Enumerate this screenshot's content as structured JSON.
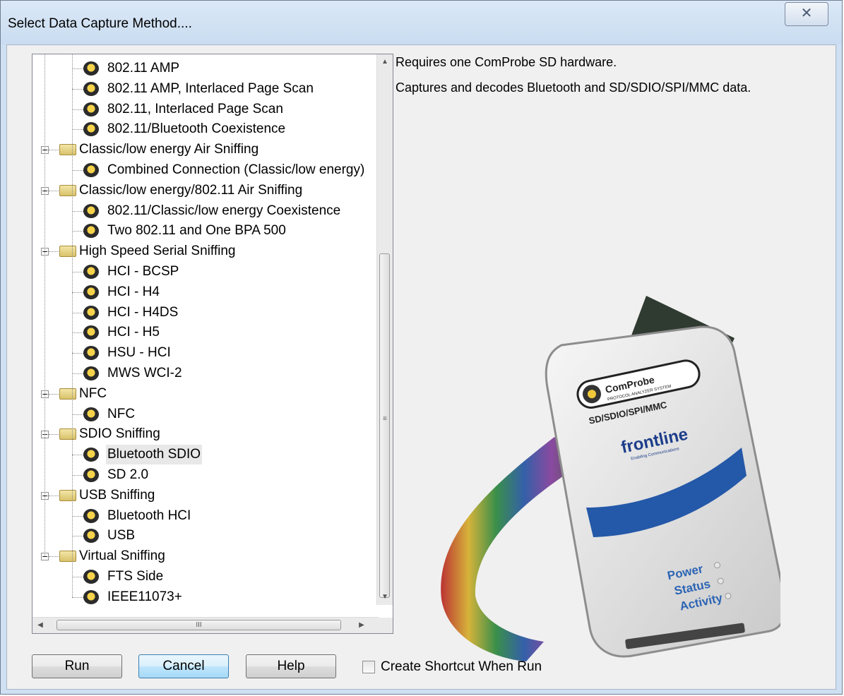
{
  "window": {
    "title": "Select Data Capture Method....",
    "close_glyph": "✕"
  },
  "tree": {
    "items": [
      {
        "label": "802.11 AMP",
        "level": 2,
        "icon": "probe-node-icon"
      },
      {
        "label": "802.11 AMP, Interlaced Page Scan",
        "level": 2,
        "icon": "probe-node-icon"
      },
      {
        "label": "802.11, Interlaced Page Scan",
        "level": 2,
        "icon": "probe-node-icon"
      },
      {
        "label": "802.11/Bluetooth Coexistence",
        "level": 2,
        "icon": "probe-node-icon"
      },
      {
        "label": "Classic/low energy Air Sniffing",
        "level": 1,
        "icon": "folder-icon",
        "expander": "−"
      },
      {
        "label": "Combined Connection (Classic/low energy)",
        "level": 2,
        "icon": "probe-node-icon"
      },
      {
        "label": "Classic/low energy/802.11 Air Sniffing",
        "level": 1,
        "icon": "folder-icon",
        "expander": "−"
      },
      {
        "label": "802.11/Classic/low energy Coexistence",
        "level": 2,
        "icon": "probe-node-icon"
      },
      {
        "label": "Two 802.11 and One BPA 500",
        "level": 2,
        "icon": "probe-node-icon"
      },
      {
        "label": "High Speed Serial Sniffing",
        "level": 1,
        "icon": "folder-icon",
        "expander": "−"
      },
      {
        "label": "HCI - BCSP",
        "level": 2,
        "icon": "probe-node-icon"
      },
      {
        "label": "HCI - H4",
        "level": 2,
        "icon": "probe-node-icon"
      },
      {
        "label": "HCI - H4DS",
        "level": 2,
        "icon": "probe-node-icon"
      },
      {
        "label": "HCI - H5",
        "level": 2,
        "icon": "probe-node-icon"
      },
      {
        "label": "HSU - HCI",
        "level": 2,
        "icon": "probe-node-icon"
      },
      {
        "label": "MWS WCI-2",
        "level": 2,
        "icon": "probe-node-icon"
      },
      {
        "label": "NFC",
        "level": 1,
        "icon": "folder-icon",
        "expander": "−"
      },
      {
        "label": "NFC",
        "level": 2,
        "icon": "probe-node-icon"
      },
      {
        "label": "SDIO Sniffing",
        "level": 1,
        "icon": "folder-icon",
        "expander": "−"
      },
      {
        "label": "Bluetooth SDIO",
        "level": 2,
        "icon": "probe-node-icon",
        "selected": true
      },
      {
        "label": "SD 2.0",
        "level": 2,
        "icon": "probe-node-icon"
      },
      {
        "label": "USB Sniffing",
        "level": 1,
        "icon": "folder-icon",
        "expander": "−"
      },
      {
        "label": "Bluetooth HCI",
        "level": 2,
        "icon": "probe-node-icon"
      },
      {
        "label": "USB",
        "level": 2,
        "icon": "probe-node-icon"
      },
      {
        "label": "Virtual Sniffing",
        "level": 1,
        "icon": "folder-icon",
        "expander": "−"
      },
      {
        "label": "FTS Side",
        "level": 2,
        "icon": "probe-node-icon"
      },
      {
        "label": "IEEE11073+",
        "level": 2,
        "icon": "probe-node-icon"
      }
    ],
    "scroll_up_glyph": "▲",
    "scroll_down_glyph": "▼",
    "scroll_left_glyph": "◀",
    "scroll_right_glyph": "▶",
    "thumb_grip_v": "≡",
    "thumb_grip_h": "III"
  },
  "description": {
    "line1": "Requires one ComProbe SD hardware.",
    "line2": "Captures and decodes Bluetooth and SD/SDIO/SPI/MMC data."
  },
  "hardware": {
    "brand": "ComProbe",
    "brand_sub": "PROTOCOL ANALYZER SYSTEM",
    "model": "SD/SDIO/SPI/MMC",
    "maker": "frontline",
    "maker_sub": "Enabling Communications",
    "led1": "Power",
    "led2": "Status",
    "led3": "Activity"
  },
  "buttons": {
    "run": "Run",
    "cancel": "Cancel",
    "help": "Help"
  },
  "shortcut": {
    "label": "Create Shortcut When Run",
    "checked": false
  }
}
